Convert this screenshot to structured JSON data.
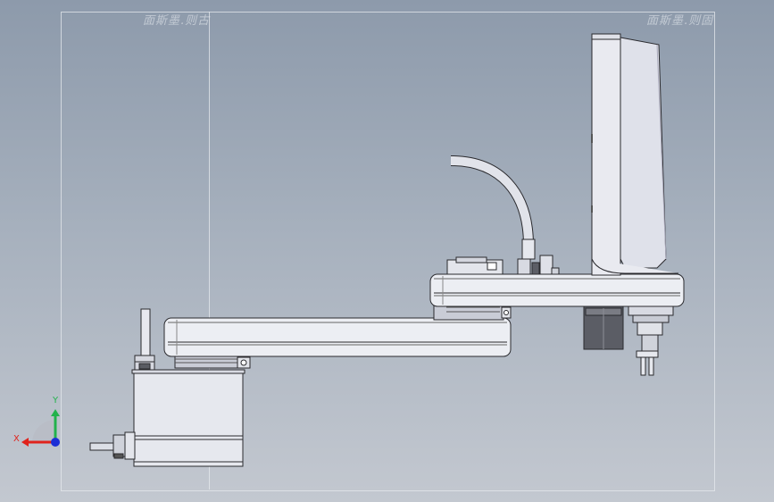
{
  "viewport": {
    "watermark_left": "面斯墨.则古",
    "watermark_right": "面斯墨.则固"
  },
  "triad": {
    "x_label": "X",
    "y_label": "Y",
    "x_color": "#e0231c",
    "y_color": "#22b24c",
    "z_color": "#1c2fd6"
  },
  "model": {
    "body_color": "#e9eaf0",
    "shade_color": "#c7c9d3",
    "dark_color": "#5e6068",
    "edge_color": "#2a2a2e"
  }
}
